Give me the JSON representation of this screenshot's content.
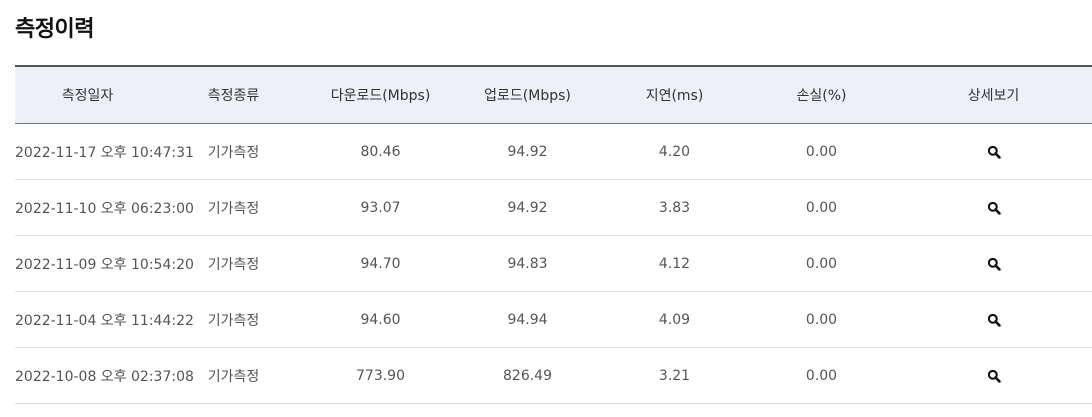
{
  "page": {
    "title": "측정이력"
  },
  "table": {
    "headers": [
      "측정일자",
      "측정종류",
      "다운로드(Mbps)",
      "업로드(Mbps)",
      "지연(ms)",
      "손실(%)",
      "상세보기"
    ],
    "rows": [
      {
        "date": "2022-11-17 오후 10:47:31",
        "type": "기가측정",
        "download": "80.46",
        "upload": "94.92",
        "latency": "4.20",
        "loss": "0.00",
        "detail_icon": "search-icon"
      },
      {
        "date": "2022-11-10 오후 06:23:00",
        "type": "기가측정",
        "download": "93.07",
        "upload": "94.92",
        "latency": "3.83",
        "loss": "0.00",
        "detail_icon": "search-icon"
      },
      {
        "date": "2022-11-09 오후 10:54:20",
        "type": "기가측정",
        "download": "94.70",
        "upload": "94.83",
        "latency": "4.12",
        "loss": "0.00",
        "detail_icon": "search-icon"
      },
      {
        "date": "2022-11-04 오후 11:44:22",
        "type": "기가측정",
        "download": "94.60",
        "upload": "94.94",
        "latency": "4.09",
        "loss": "0.00",
        "detail_icon": "search-icon"
      },
      {
        "date": "2022-10-08 오후 02:37:08",
        "type": "기가측정",
        "download": "773.90",
        "upload": "826.49",
        "latency": "3.21",
        "loss": "0.00",
        "detail_icon": "search-icon"
      }
    ]
  },
  "colors": {
    "header_background": "#edf0f9",
    "header_top_border": "#555555",
    "row_divider": "#e3e3e3",
    "title_text": "#111111",
    "cell_text": "#555555"
  }
}
